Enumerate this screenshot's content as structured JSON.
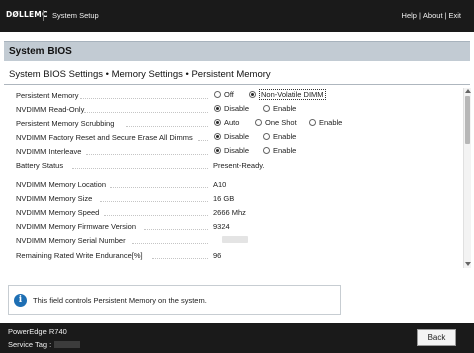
{
  "header": {
    "logo_text": "DØLLEMC",
    "app_title": "System Setup",
    "links": [
      {
        "label": "Help"
      },
      {
        "label": "About"
      },
      {
        "label": "Exit"
      }
    ],
    "separator": "|"
  },
  "page": {
    "title": "System BIOS",
    "breadcrumb": "System BIOS Settings • Memory Settings • Persistent Memory"
  },
  "settings": {
    "persistent_memory": {
      "label": "Persistent Memory",
      "options": [
        "Off",
        "Non-Volatile DIMM"
      ],
      "selected": "Non-Volatile DIMM"
    },
    "nvdimm_read_only": {
      "label": "NVDIMM Read-Only",
      "options": [
        "Disable",
        "Enable"
      ],
      "selected": "Disable"
    },
    "persistent_memory_scrubbing": {
      "label": "Persistent Memory Scrubbing",
      "options": [
        "Auto",
        "One Shot",
        "Enable"
      ],
      "selected": "Auto"
    },
    "nvdimm_factory_reset": {
      "label": "NVDIMM Factory Reset and Secure Erase All Dimms",
      "options": [
        "Disable",
        "Enable"
      ],
      "selected": "Disable"
    },
    "nvdimm_interleave": {
      "label": "NVDIMM Interleave",
      "options": [
        "Disable",
        "Enable"
      ],
      "selected": "Disable"
    },
    "battery_status": {
      "label": "Battery Status",
      "value": "Present-Ready."
    },
    "nvdimm_memory_location": {
      "label": "NVDIMM Memory Location",
      "value": "A10"
    },
    "nvdimm_memory_size": {
      "label": "NVDIMM Memory Size",
      "value": "16 GB"
    },
    "nvdimm_memory_speed": {
      "label": "NVDIMM Memory Speed",
      "value": "2666 Mhz"
    },
    "nvdimm_firmware_version": {
      "label": "NVDIMM Memory Firmware Version",
      "value": "9324"
    },
    "nvdimm_serial_number": {
      "label": "NVDIMM Memory Serial Number"
    },
    "remaining_endurance": {
      "label": "Remaining Rated Write Endurance[%]",
      "value": "96"
    }
  },
  "help": {
    "icon": "info-icon",
    "text": "This field controls Persistent Memory on the system."
  },
  "footer": {
    "model": "PowerEdge R740",
    "service_tag_label": "Service Tag :",
    "back_label": "Back"
  },
  "colors": {
    "header_bg": "#1a1a1a",
    "title_band": "#c2cbd3",
    "info_icon": "#1e6fb4"
  }
}
